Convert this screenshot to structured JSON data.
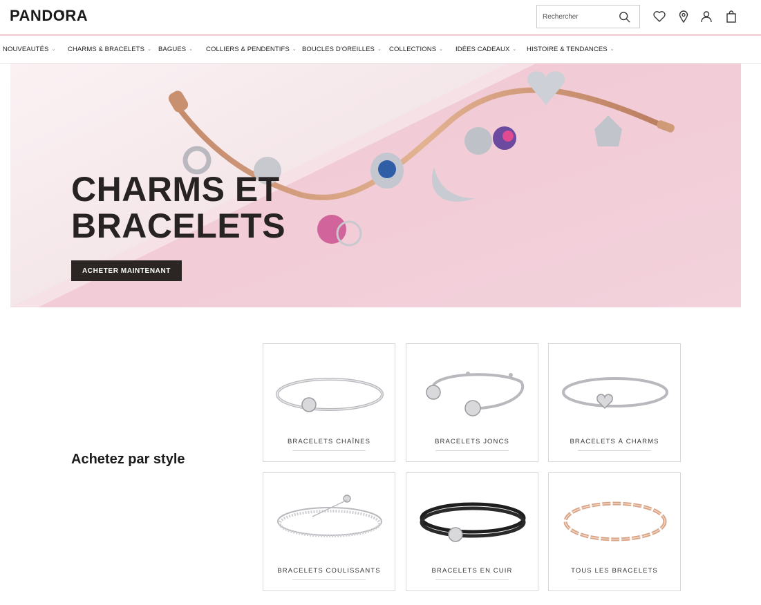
{
  "header": {
    "logo": "PANDORA",
    "search_placeholder": "Rechercher"
  },
  "nav": {
    "items": [
      {
        "label": "NOUVEAUTÉS"
      },
      {
        "label": "CHARMS & BRACELETS"
      },
      {
        "label": "BAGUES"
      },
      {
        "label": "COLLIERS & PENDENTIFS"
      },
      {
        "label": "BOUCLES D'OREILLES"
      },
      {
        "label": "COLLECTIONS"
      },
      {
        "label": "IDÉES CADEAUX"
      },
      {
        "label": "HISTOIRE & TENDANCES"
      }
    ]
  },
  "hero": {
    "title_line1": "CHARMS ET",
    "title_line2": "BRACELETS",
    "cta": "ACHETER MAINTENANT"
  },
  "shop_by_style": {
    "heading": "Achetez par style",
    "tiles": [
      {
        "label": "BRACELETS CHAÎNES"
      },
      {
        "label": "BRACELETS JONCS"
      },
      {
        "label": "BRACELETS À CHARMS"
      },
      {
        "label": "BRACELETS COULISSANTS"
      },
      {
        "label": "BRACELETS EN CUIR"
      },
      {
        "label": "TOUS LES BRACELETS"
      }
    ]
  },
  "colors": {
    "accent_pink": "#f6d3d8",
    "hero_bg": "#f2cdd8",
    "button_dark": "#2b2623",
    "text": "#1b1b1b"
  },
  "icons": [
    "search-icon",
    "heart-icon",
    "location-pin-icon",
    "user-icon",
    "shopping-bag-icon",
    "chevron-down-icon"
  ]
}
